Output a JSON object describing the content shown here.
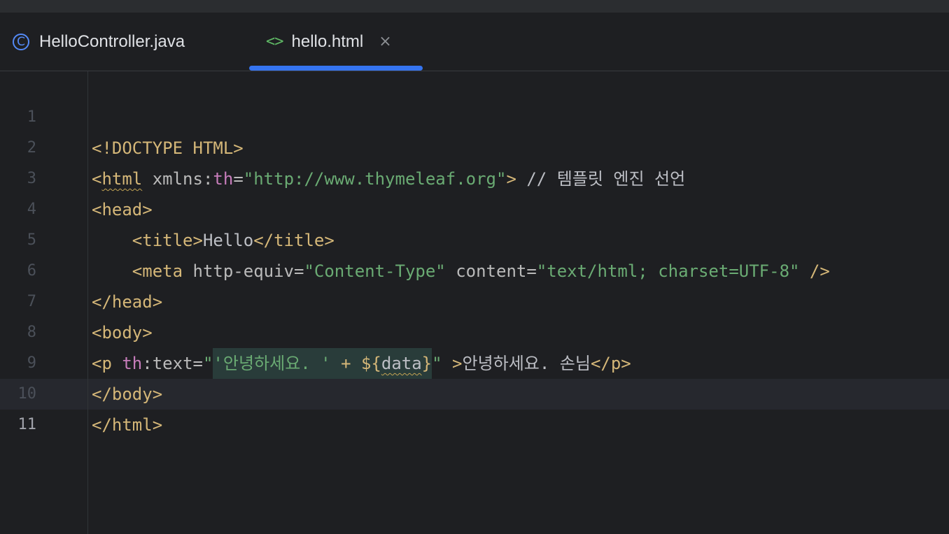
{
  "tabs": [
    {
      "label": "HelloController.java",
      "icon": "class-c-icon",
      "active": false
    },
    {
      "label": "hello.html",
      "icon": "html-code-icon",
      "active": true,
      "close_glyph": "×"
    }
  ],
  "icons": {
    "class_glyph": "C",
    "html_glyph": "<>"
  },
  "colors": {
    "accent": "#3574f0",
    "tag": "#d5b778",
    "string": "#6aab73",
    "namespace": "#c77dbb"
  },
  "editor": {
    "current_line": 11,
    "line_numbers": [
      "1",
      "2",
      "3",
      "4",
      "5",
      "6",
      "7",
      "8",
      "9",
      "10",
      "11"
    ],
    "lines": {
      "l1": {
        "t1": "<!DOCTYPE HTML>"
      },
      "l2": {
        "t1": "<",
        "t2": "html",
        "t3": " xmlns:",
        "t4": "th",
        "t5": "=",
        "t6": "\"http://www.thymeleaf.org\"",
        "t7": ">",
        "t8": " // 템플릿 엔진 선언"
      },
      "l3": {
        "t1": "<head>"
      },
      "l4": {
        "t0": "    ",
        "t1": "<title>",
        "t2": "Hello",
        "t3": "</title>"
      },
      "l5": {
        "t0": "    ",
        "t1": "<meta",
        "t2": " http-equiv",
        "t3": "=",
        "t4": "\"Content-Type\"",
        "t5": " content",
        "t6": "=",
        "t7": "\"text/html; charset=UTF-8\"",
        "t8": " />"
      },
      "l6": {
        "t1": "</head>"
      },
      "l7": {
        "t1": "<body>"
      },
      "l8": {
        "t1": "<p",
        "t2": " ",
        "t3": "th",
        "t4": ":text",
        "t5": "=",
        "t6": "\"",
        "t7": "'안녕하세요. '",
        "t8": " + ${",
        "t9": "data",
        "t10": "}",
        "t11": "\"",
        "t12": " >",
        "t13": "안녕하세요. 손님",
        "t14": "</p>"
      },
      "l9": {
        "t1": "</body>"
      },
      "l10": {
        "t1": "</html>"
      },
      "l11": {
        "t1": ""
      }
    }
  }
}
